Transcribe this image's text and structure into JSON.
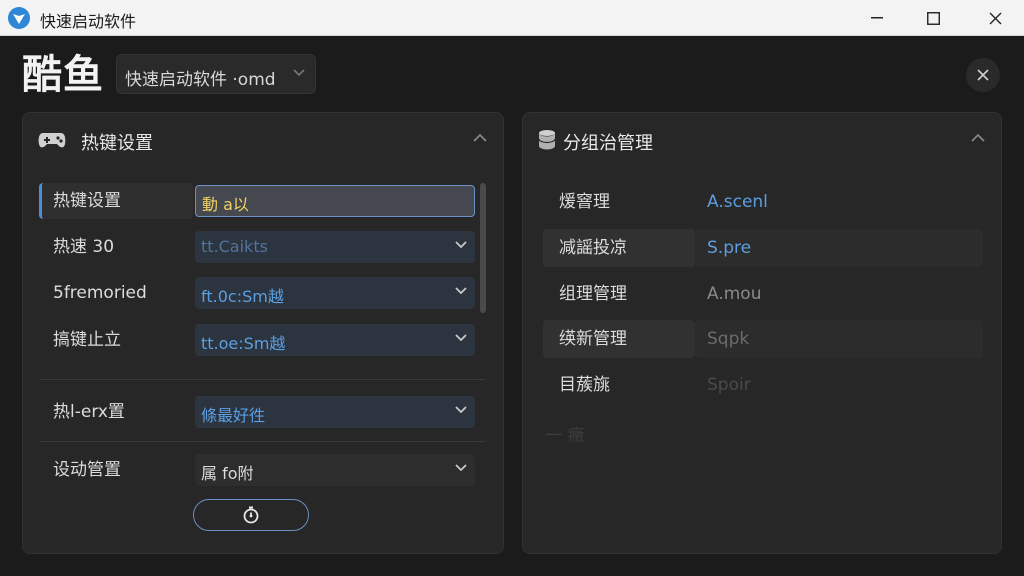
{
  "window": {
    "title": "快速启动软件",
    "minimize_icon": "minimize-icon",
    "maximize_icon": "maximize-icon",
    "close_icon": "close-icon"
  },
  "header": {
    "brand": "酷鱼",
    "profile_select": {
      "value": "快速启动软件 ·omd",
      "icon": "chevron-down-icon"
    },
    "close_icon": "close-icon"
  },
  "left_panel": {
    "title": "热键设置",
    "icon": "gamepad-icon",
    "rows": [
      {
        "label": "热键设置",
        "value": "動 a以"
      },
      {
        "label": "热速 30",
        "value": "tt.Caikts"
      },
      {
        "label": "5fremoried",
        "value": "ft.0c:Ѕm越"
      },
      {
        "label": "搞键止立",
        "value": "tt.oe:Ѕm越"
      }
    ],
    "rows_bottom": [
      {
        "label": "热l-erx置",
        "value": "條最好徃"
      },
      {
        "label": "设动管置",
        "value": "属 fo附"
      }
    ],
    "timer_icon": "timer-icon"
  },
  "right_panel": {
    "title": "分组治管理",
    "icon": "database-icon",
    "rows": [
      {
        "label": "煖窨理",
        "value": "A.scenl",
        "value_color": "#5c9fe0"
      },
      {
        "label": "减謡投凉",
        "value": "S.pre",
        "value_color": "#5c9fe0"
      },
      {
        "label": "组理管理",
        "value": "A.mou",
        "value_color": "#8a8a8a"
      },
      {
        "label": "绬新管理",
        "value": "Sqpk",
        "value_color": "#6c6c6c"
      },
      {
        "label": "目蔟旐",
        "value": "Spoir",
        "value_color": "#4a4a4a"
      }
    ],
    "faint_item": "一 癥"
  },
  "colors": {
    "accent": "#4a90d9",
    "highlight_text": "#f0d060",
    "panel_bg": "#272727",
    "window_bg": "#1b1b1b"
  }
}
